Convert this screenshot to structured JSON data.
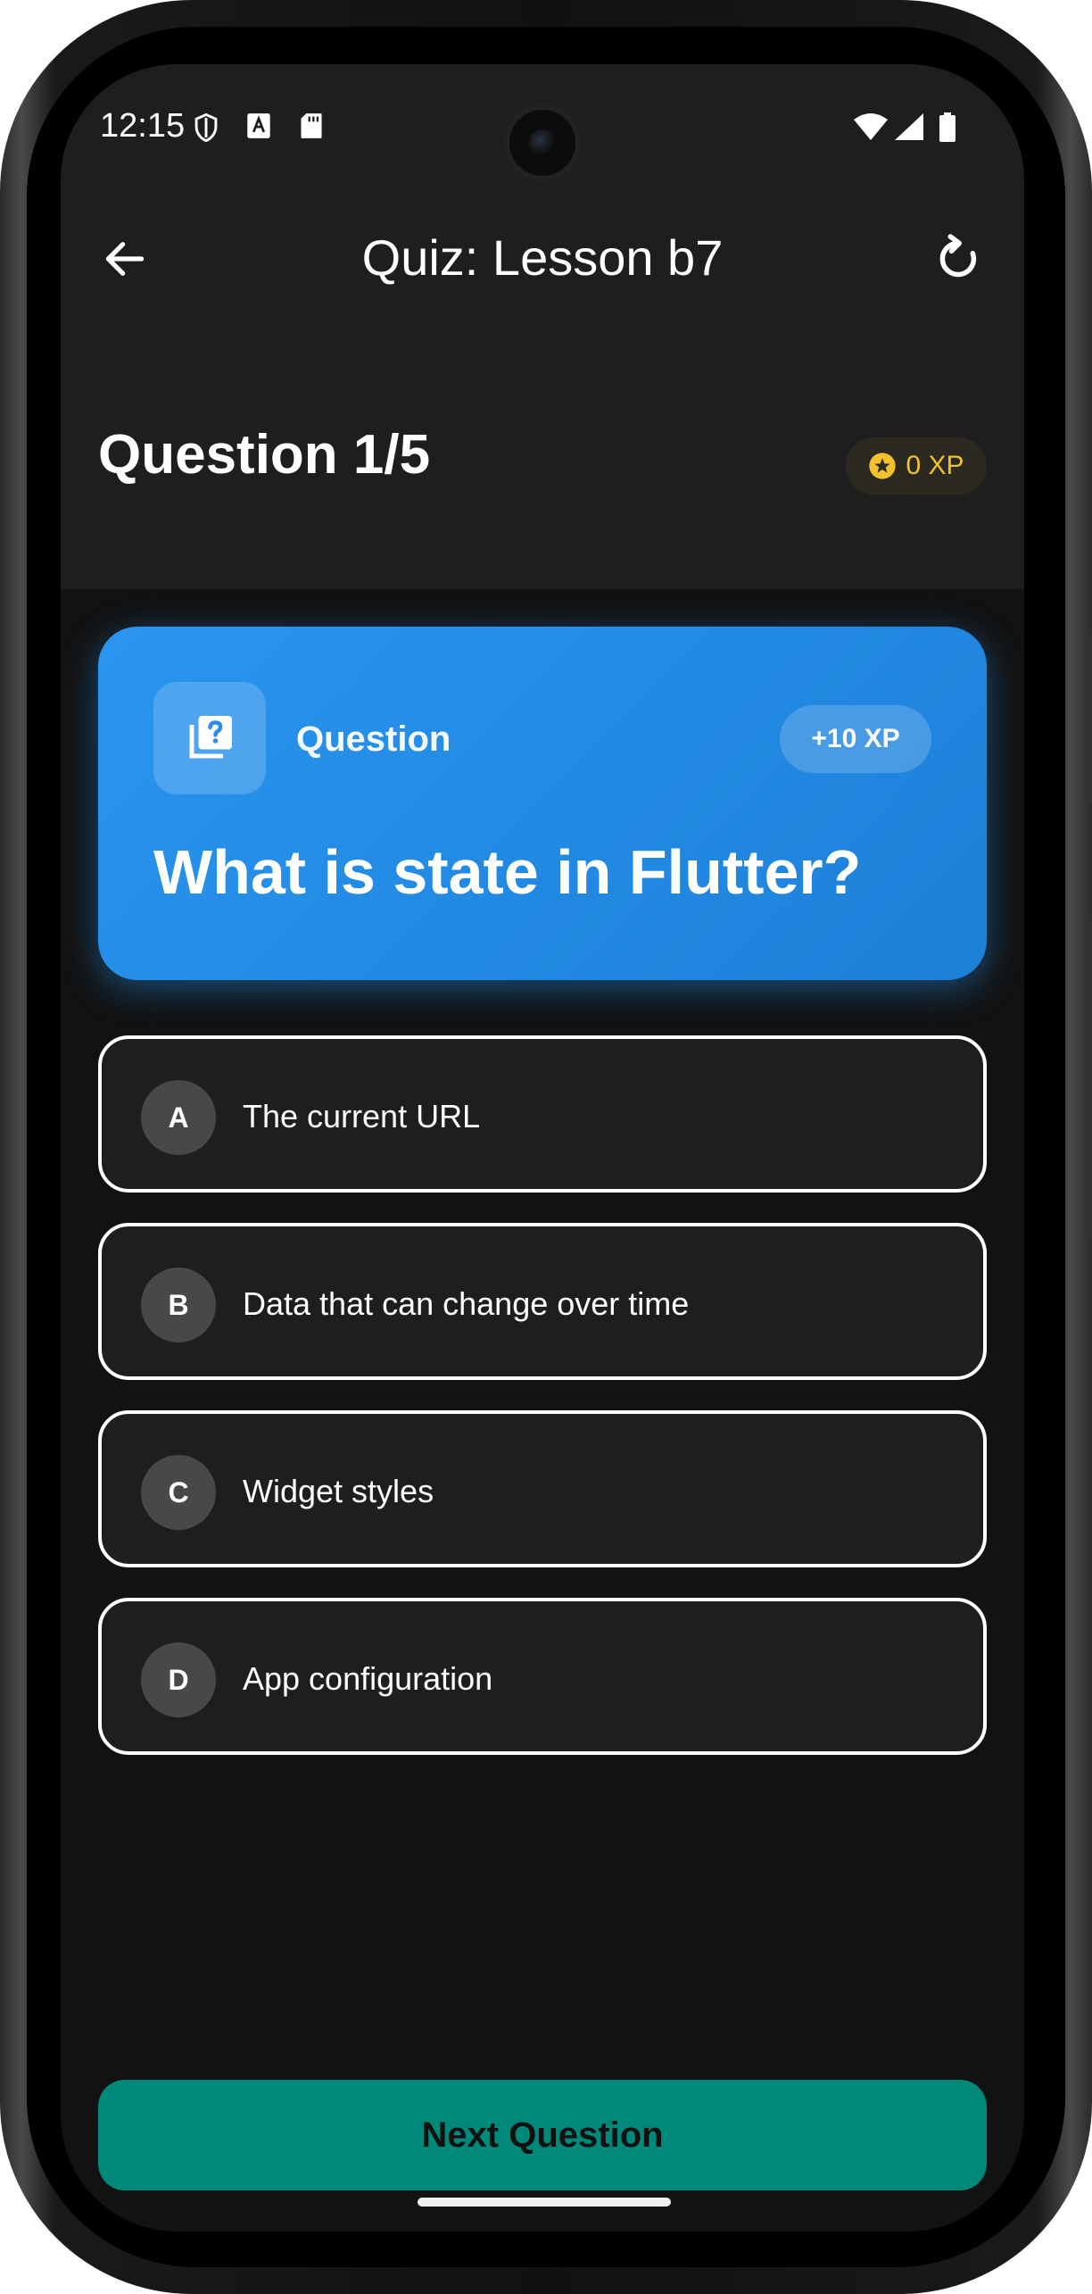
{
  "status_bar": {
    "time": "12:15",
    "icons": [
      "shield-icon",
      "text-a-icon",
      "sd-card-icon",
      "wifi-icon",
      "signal-icon",
      "battery-icon"
    ]
  },
  "app_bar": {
    "title": "Quiz: Lesson b7",
    "back_icon": "arrow-back-icon",
    "refresh_icon": "refresh-icon"
  },
  "header": {
    "question_counter": "Question 1/5",
    "xp_total": "0 XP",
    "progress": 0
  },
  "question_card": {
    "label": "Question",
    "xp_reward": "+10 XP",
    "text": "What is state in Flutter?"
  },
  "options": [
    {
      "letter": "A",
      "text": "The current URL"
    },
    {
      "letter": "B",
      "text": "Data that can change over time"
    },
    {
      "letter": "C",
      "text": "Widget styles"
    },
    {
      "letter": "D",
      "text": "App configuration"
    }
  ],
  "footer": {
    "next_label": "Next Question"
  },
  "colors": {
    "background": "#121212",
    "surface": "#1e1e1e",
    "accent_blue": "#2196f3",
    "xp_gold": "#f2c12e",
    "button_teal": "#00897b"
  }
}
